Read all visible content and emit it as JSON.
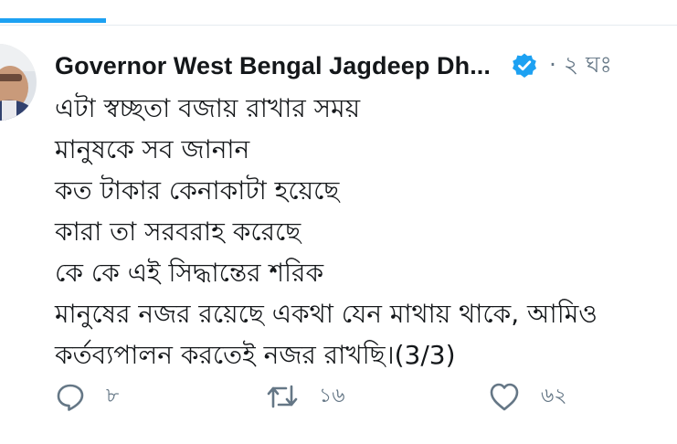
{
  "tweet": {
    "author": "Governor West Bengal Jagdeep Dh...",
    "time": "· ২ ঘঃ",
    "lines": [
      "এটা স্বচ্ছতা বজায় রাখার সময়",
      "মানুষকে সব জানান",
      "কত টাকার কেনাকাটা হয়েছে",
      "কারা তা সরবরাহ করেছে",
      "কে কে এই সিদ্ধান্তের শরিক",
      "মানুষের নজর রয়েছে একথা যেন মাথায় থাকে, আমিও",
      "কর্তব্যপালন করতেই নজর রাখছি।(3/3)"
    ]
  },
  "actions": {
    "reply_count": "৮",
    "retweet_count": "১৬",
    "like_count": "৬২"
  },
  "colors": {
    "accent": "#1da1f2",
    "text": "#14171a",
    "muted": "#657786"
  },
  "icons": [
    "avatar-photo",
    "verified-badge-icon",
    "reply-icon",
    "retweet-icon",
    "like-heart-icon"
  ]
}
